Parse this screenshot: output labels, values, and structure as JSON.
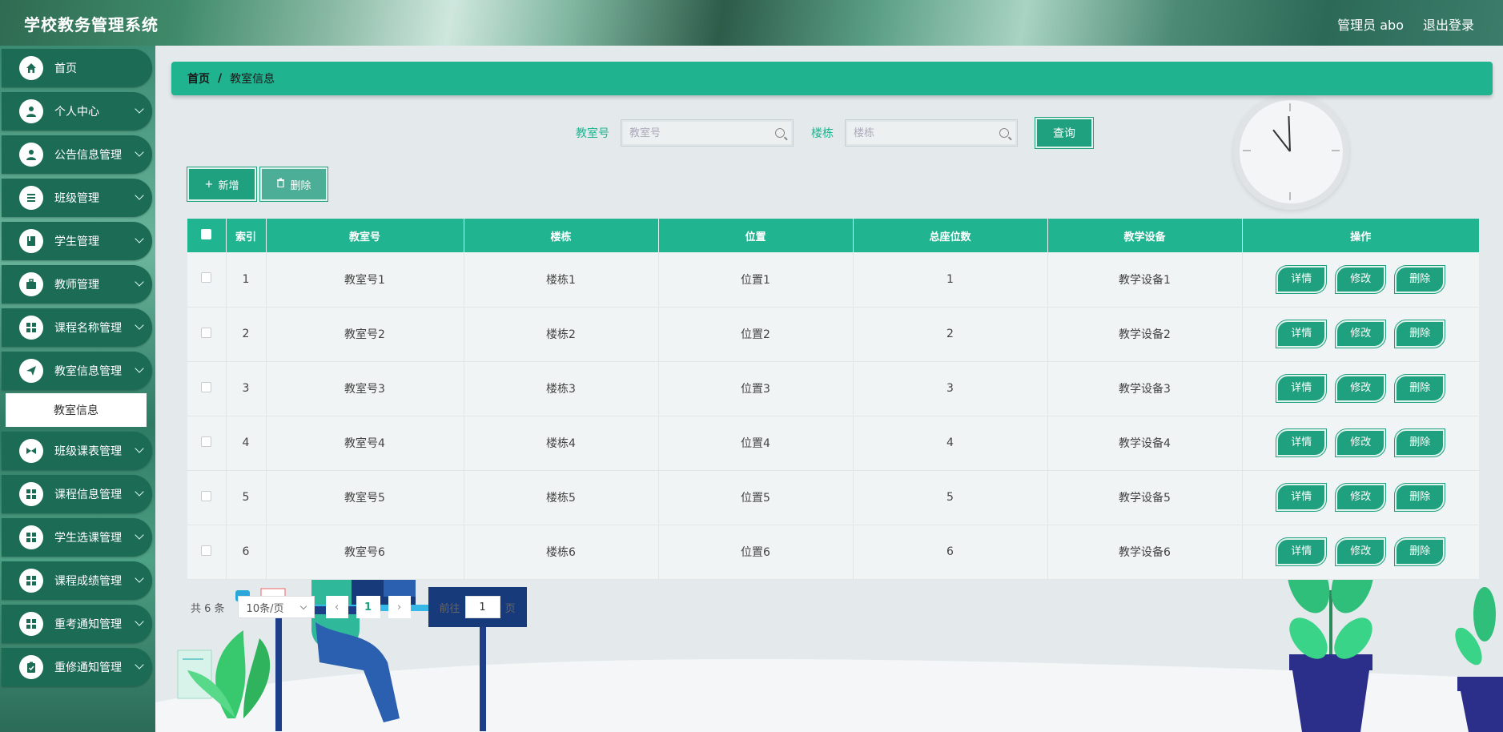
{
  "header": {
    "title": "学校教务管理系统",
    "user": "管理员 abo",
    "logout": "退出登录"
  },
  "sidebar": {
    "items": [
      {
        "label": "首页",
        "icon": "home-icon",
        "chevron": false
      },
      {
        "label": "个人中心",
        "icon": "user-icon",
        "chevron": true
      },
      {
        "label": "公告信息管理",
        "icon": "user-icon",
        "chevron": true
      },
      {
        "label": "班级管理",
        "icon": "list-icon",
        "chevron": true
      },
      {
        "label": "学生管理",
        "icon": "book-icon",
        "chevron": true
      },
      {
        "label": "教师管理",
        "icon": "briefcase-icon",
        "chevron": true
      },
      {
        "label": "课程名称管理",
        "icon": "grid-icon",
        "chevron": true
      },
      {
        "label": "教室信息管理",
        "icon": "send-icon",
        "chevron": true
      },
      {
        "label": "班级课表管理",
        "icon": "video-icon",
        "chevron": true
      },
      {
        "label": "课程信息管理",
        "icon": "grid-icon",
        "chevron": true
      },
      {
        "label": "学生选课管理",
        "icon": "grid-icon",
        "chevron": true
      },
      {
        "label": "课程成绩管理",
        "icon": "grid-icon",
        "chevron": true
      },
      {
        "label": "重考通知管理",
        "icon": "grid-icon",
        "chevron": true
      },
      {
        "label": "重修通知管理",
        "icon": "clipboard-icon",
        "chevron": true
      }
    ],
    "active_sub": "教室信息"
  },
  "breadcrumb": {
    "home": "首页",
    "sep": "/",
    "current": "教室信息"
  },
  "search": {
    "room_label": "教室号",
    "room_placeholder": "教室号",
    "building_label": "楼栋",
    "building_placeholder": "楼栋",
    "query": "查询"
  },
  "actions": {
    "add": "新增",
    "delete": "删除"
  },
  "table": {
    "headers": [
      "索引",
      "教室号",
      "楼栋",
      "位置",
      "总座位数",
      "教学设备",
      "操作"
    ],
    "rows": [
      [
        "1",
        "教室号1",
        "楼栋1",
        "位置1",
        "1",
        "教学设备1"
      ],
      [
        "2",
        "教室号2",
        "楼栋2",
        "位置2",
        "2",
        "教学设备2"
      ],
      [
        "3",
        "教室号3",
        "楼栋3",
        "位置3",
        "3",
        "教学设备3"
      ],
      [
        "4",
        "教室号4",
        "楼栋4",
        "位置4",
        "4",
        "教学设备4"
      ],
      [
        "5",
        "教室号5",
        "楼栋5",
        "位置5",
        "5",
        "教学设备5"
      ],
      [
        "6",
        "教室号6",
        "楼栋6",
        "位置6",
        "6",
        "教学设备6"
      ]
    ],
    "ops": {
      "detail": "详情",
      "edit": "修改",
      "delete": "删除"
    }
  },
  "pagination": {
    "total": "共 6 条",
    "page_size": "10条/页",
    "current_page": "1",
    "goto_prefix": "前往",
    "goto_value": "1",
    "goto_suffix": "页"
  },
  "colors": {
    "accent": "#1fb48f",
    "sidebar": "#1c6b55",
    "button": "#1fa07e"
  }
}
